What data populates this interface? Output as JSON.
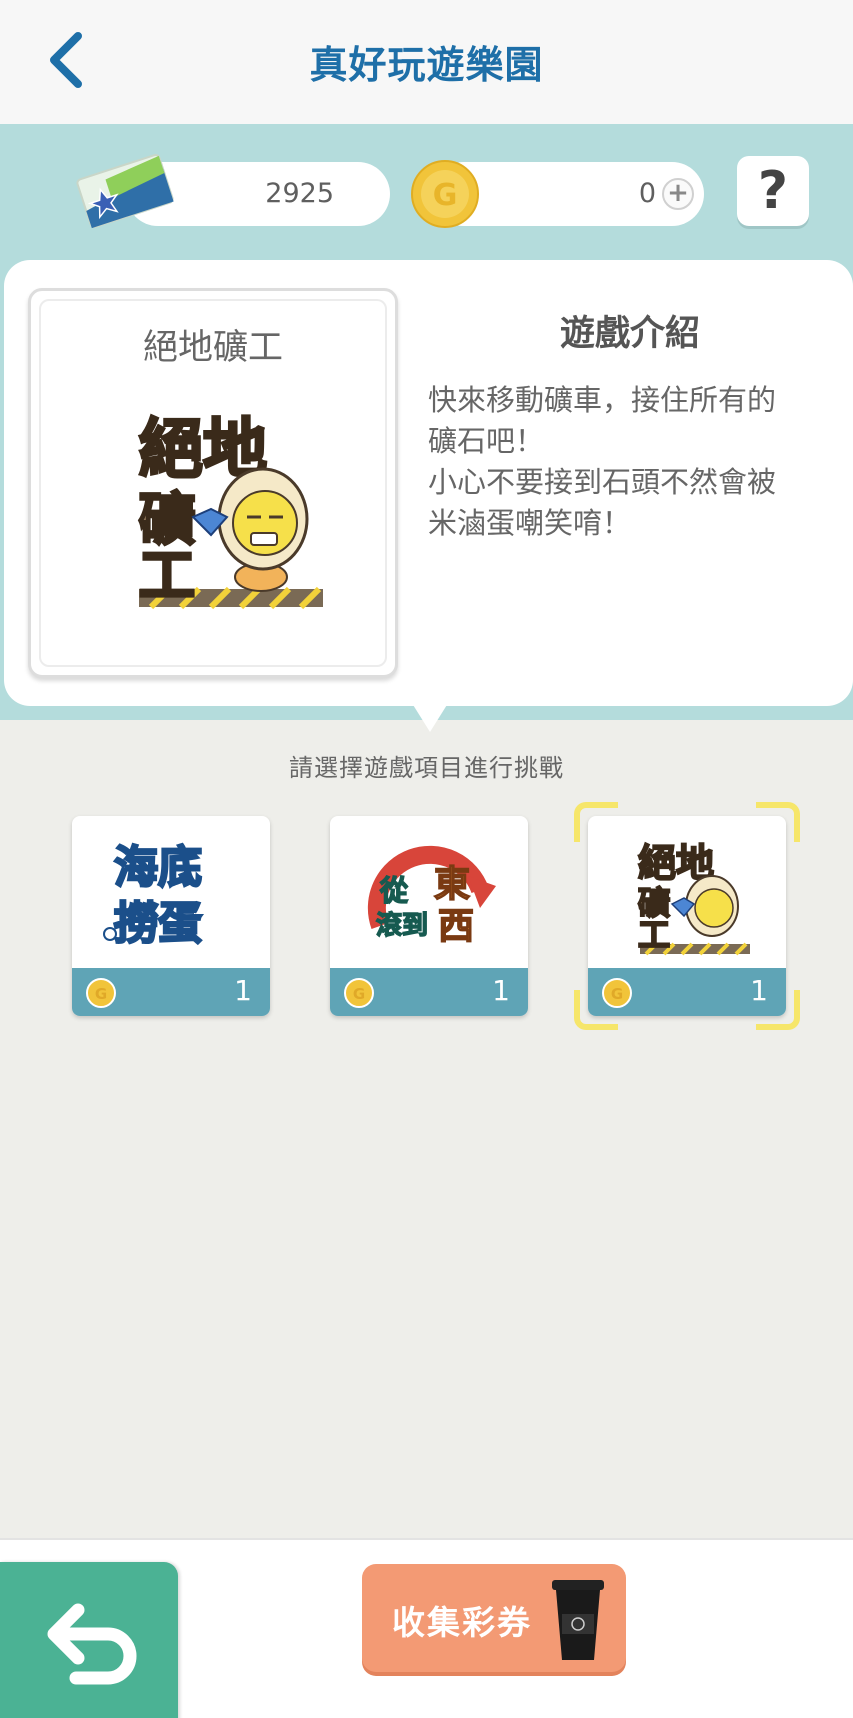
{
  "header": {
    "title": "真好玩遊樂園"
  },
  "wallet": {
    "tickets": "2925",
    "coins": "0",
    "plus": "+",
    "help": "?"
  },
  "game": {
    "name": "絕地礦工",
    "logo_line1": "絕地",
    "logo_line2": "礦",
    "logo_line3": "工",
    "intro_title": "遊戲介紹",
    "intro_body": "快來移動礦車，接住所有的\n礦石吧！\n小心不要接到石頭不然會被\n米滷蛋嘲笑唷！"
  },
  "prompt": "請選擇遊戲項目進行挑戰",
  "games": [
    {
      "logo_top": "海底",
      "logo_bottom": "撈蛋",
      "cost": "1"
    },
    {
      "logo_top": "從",
      "logo_mid": "東",
      "logo_bottom": "滾到",
      "logo_end": "西",
      "cost": "1"
    },
    {
      "logo_top": "絕地",
      "logo_mid": "礦",
      "logo_bottom": "工",
      "cost": "1",
      "selected": true
    }
  ],
  "bottom": {
    "collect_label": "收集彩券"
  },
  "colors": {
    "title": "#1e6fa8",
    "band": "#b4dcdc",
    "tile_bar": "#5fa4b6",
    "return_btn": "#4bb294",
    "collect_btn": "#f39a74",
    "select": "#f6e66a"
  }
}
